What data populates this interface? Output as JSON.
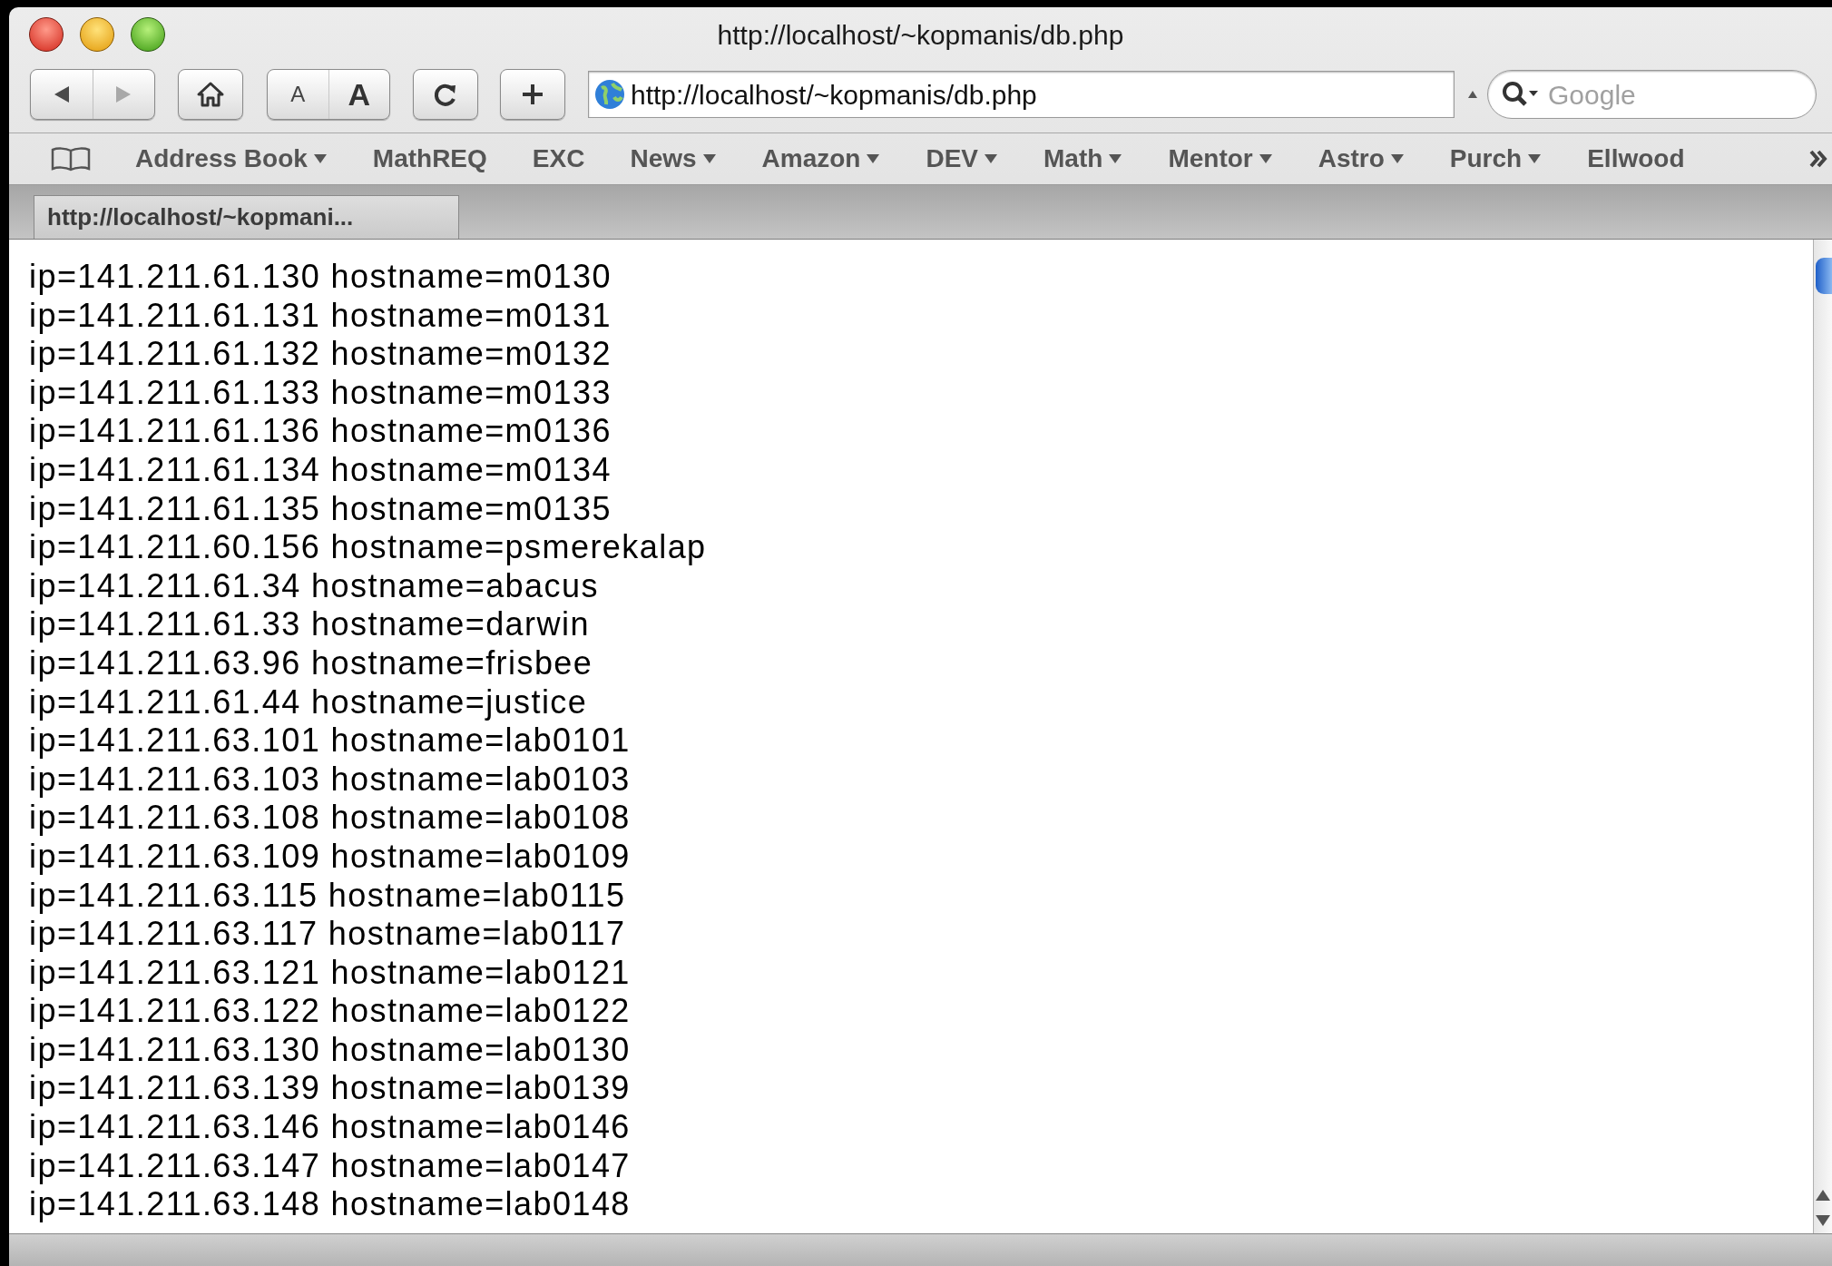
{
  "window": {
    "title": "http://localhost/~kopmanis/db.php"
  },
  "toolbar": {
    "text_size_buttons": [
      "A",
      "A"
    ],
    "address": "http://localhost/~kopmanis/db.php",
    "search": {
      "placeholder": "Google"
    }
  },
  "bookmarks": [
    {
      "label": "Address Book",
      "menu": true
    },
    {
      "label": "MathREQ",
      "menu": false
    },
    {
      "label": "EXC",
      "menu": false
    },
    {
      "label": "News",
      "menu": true
    },
    {
      "label": "Amazon",
      "menu": true
    },
    {
      "label": "DEV",
      "menu": true
    },
    {
      "label": "Math",
      "menu": true
    },
    {
      "label": "Mentor",
      "menu": true
    },
    {
      "label": "Astro",
      "menu": true
    },
    {
      "label": "Purch",
      "menu": true
    },
    {
      "label": "Ellwood",
      "menu": false
    }
  ],
  "tabs": [
    {
      "label": "http://localhost/~kopmani...",
      "selected": true
    }
  ],
  "content": {
    "lines": [
      "ip=141.211.61.130 hostname=m0130",
      "ip=141.211.61.131 hostname=m0131",
      "ip=141.211.61.132 hostname=m0132",
      "ip=141.211.61.133 hostname=m0133",
      "ip=141.211.61.136 hostname=m0136",
      "ip=141.211.61.134 hostname=m0134",
      "ip=141.211.61.135 hostname=m0135",
      "ip=141.211.60.156 hostname=psmerekalap",
      "ip=141.211.61.34 hostname=abacus",
      "ip=141.211.61.33 hostname=darwin",
      "ip=141.211.63.96 hostname=frisbee",
      "ip=141.211.61.44 hostname=justice",
      "ip=141.211.63.101 hostname=lab0101",
      "ip=141.211.63.103 hostname=lab0103",
      "ip=141.211.63.108 hostname=lab0108",
      "ip=141.211.63.109 hostname=lab0109",
      "ip=141.211.63.115 hostname=lab0115",
      "ip=141.211.63.117 hostname=lab0117",
      "ip=141.211.63.121 hostname=lab0121",
      "ip=141.211.63.122 hostname=lab0122",
      "ip=141.211.63.130 hostname=lab0130",
      "ip=141.211.63.139 hostname=lab0139",
      "ip=141.211.63.146 hostname=lab0146",
      "ip=141.211.63.147 hostname=lab0147",
      "ip=141.211.63.148 hostname=lab0148"
    ]
  }
}
